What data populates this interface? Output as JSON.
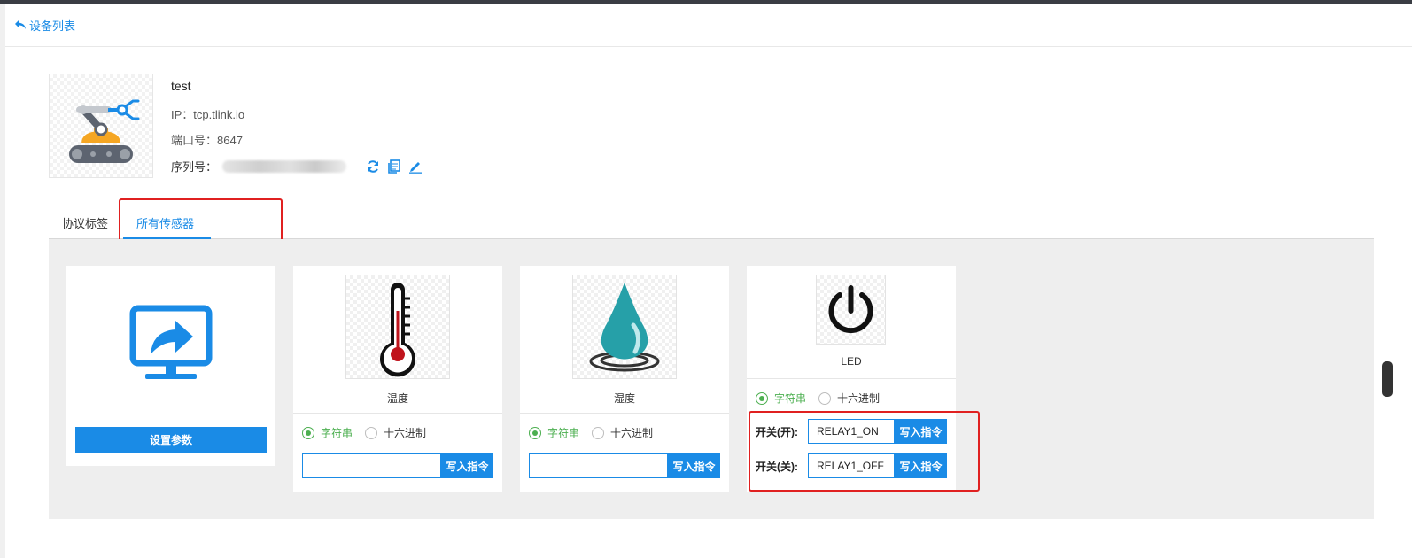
{
  "header": {
    "back_label": "设备列表"
  },
  "device": {
    "name": "test",
    "ip_label": "IP：",
    "ip_value": "tcp.tlink.io",
    "port_label": "端口号：",
    "port_value": "8647",
    "serial_label": "序列号："
  },
  "tabs": [
    {
      "label": "协议标签",
      "active": false
    },
    {
      "label": "所有传感器",
      "active": true
    }
  ],
  "cards": {
    "settings": {
      "button_label": "设置参数"
    },
    "temperature": {
      "name": "温度",
      "radio_string": "字符串",
      "radio_hex": "十六进制",
      "selected": "string",
      "input_value": "",
      "write_label": "写入指令"
    },
    "humidity": {
      "name": "湿度",
      "radio_string": "字符串",
      "radio_hex": "十六进制",
      "selected": "string",
      "input_value": "",
      "write_label": "写入指令"
    },
    "led": {
      "name": "LED",
      "radio_string": "字符串",
      "radio_hex": "十六进制",
      "selected": "string",
      "switch_on_label": "开关(开):",
      "switch_on_value": "RELAY1_ON",
      "switch_off_label": "开关(关):",
      "switch_off_value": "RELAY1_OFF",
      "write_label": "写入指令"
    }
  },
  "colors": {
    "accent": "#1a8be6",
    "radio_on": "#4caf50",
    "highlight": "#e02020"
  },
  "icons": [
    "back-arrow-icon",
    "refresh-icon",
    "copy-icon",
    "edit-icon",
    "robot-arm-image",
    "share-screen-icon",
    "thermometer-icon",
    "water-drop-icon",
    "power-icon"
  ]
}
